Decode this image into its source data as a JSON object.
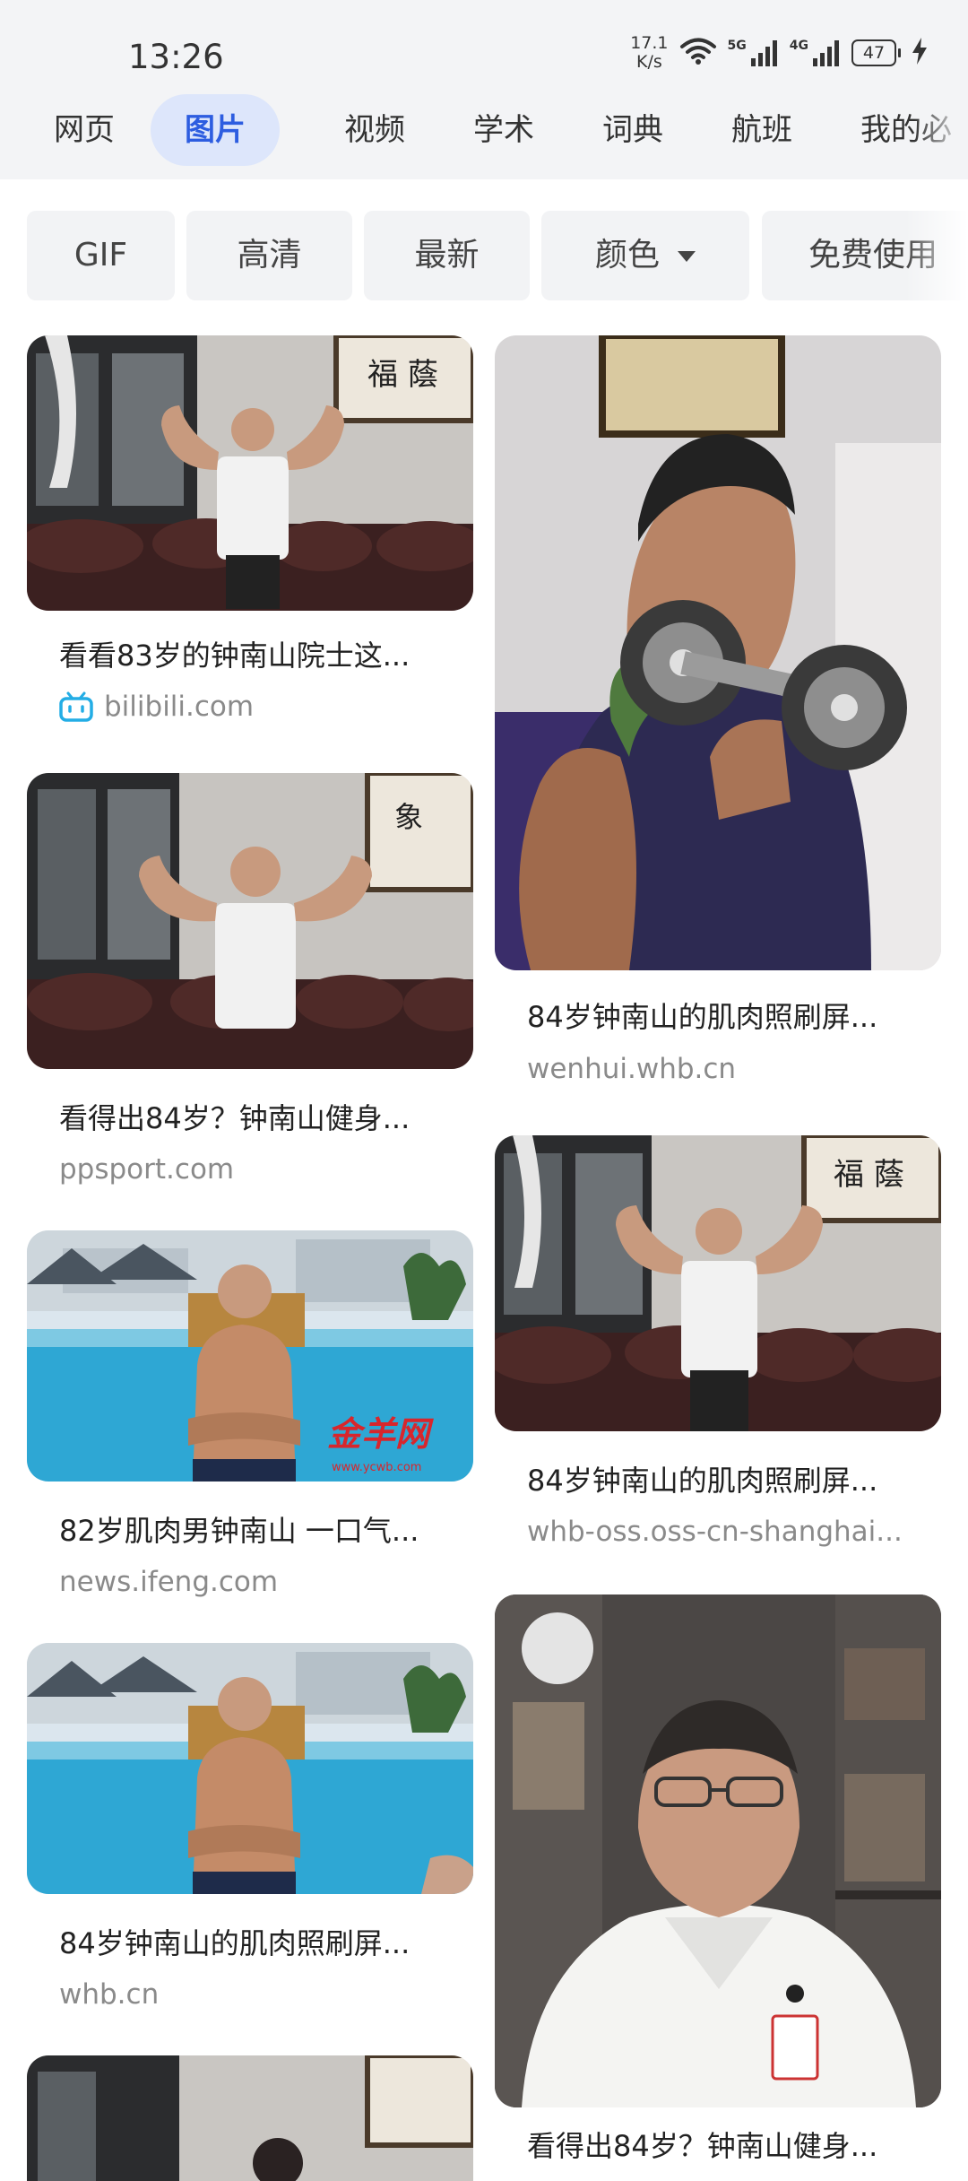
{
  "status": {
    "time": "13:26",
    "net_speed_value": "17.1",
    "net_speed_unit": "K/s",
    "sig1_label": "5G",
    "sig2_label": "4G",
    "battery": "47"
  },
  "nav_tabs": [
    "网页",
    "图片",
    "视频",
    "学术",
    "词典",
    "航班",
    "我的必"
  ],
  "nav_active_index": 1,
  "filters": [
    "GIF",
    "高清",
    "最新",
    "颜色",
    "免费使用"
  ],
  "results_left": [
    {
      "caption": "看看83岁的钟南山院士这...",
      "source": "bilibili.com",
      "source_icon": "bilibili-icon"
    },
    {
      "caption": "看得出84岁？钟南山健身...",
      "source": "ppsport.com"
    },
    {
      "caption": "82岁肌肉男钟南山 一口气...",
      "source": "news.ifeng.com",
      "watermark": "金羊网",
      "watermark_url": "www.ycwb.com"
    },
    {
      "caption": "84岁钟南山的肌肉照刷屏...",
      "source": "whb.cn"
    }
  ],
  "results_right": [
    {
      "caption": "84岁钟南山的肌肉照刷屏...",
      "source": "wenhui.whb.cn"
    },
    {
      "caption": "84岁钟南山的肌肉照刷屏...",
      "source": "whb-oss.oss-cn-shanghai..."
    },
    {
      "caption": "看得出84岁？钟南山健身..."
    }
  ],
  "colors": {
    "accent": "#2d5de0",
    "accent_bg": "#dde6fb",
    "topbar_bg": "#f3f4f6",
    "chip_bg": "#f2f3f5",
    "source_text": "#8a8a8a"
  }
}
